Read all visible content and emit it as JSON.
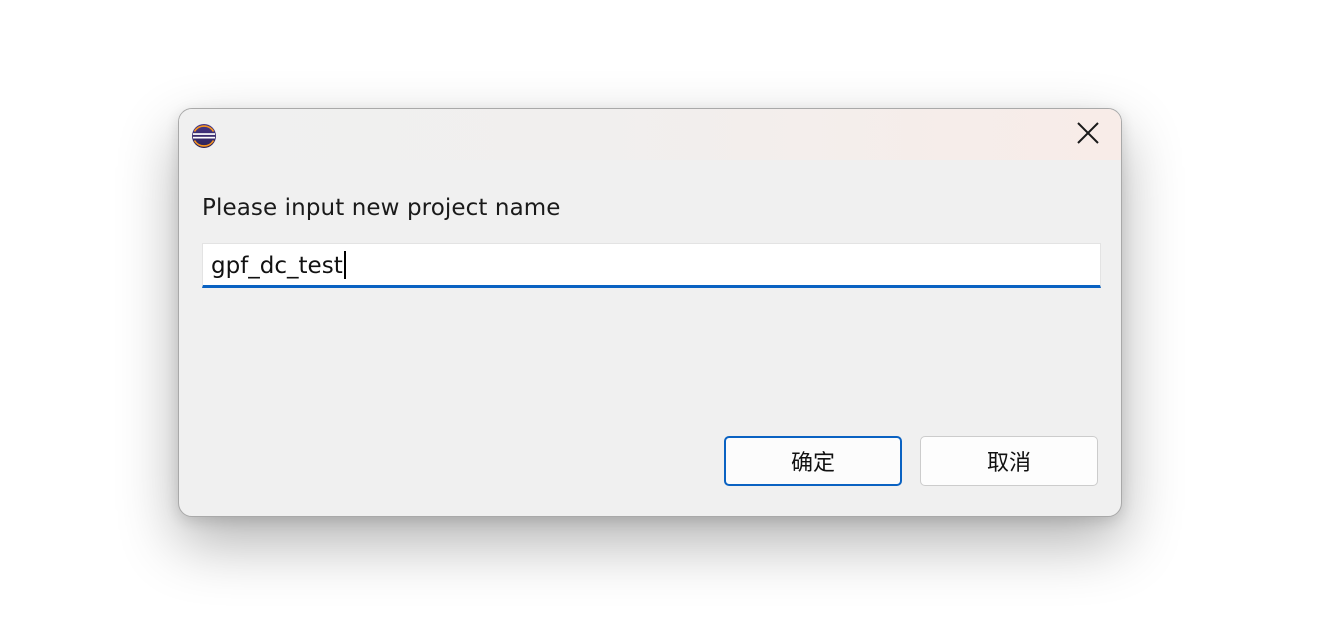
{
  "dialog": {
    "app_icon": "eclipse-icon",
    "close_icon": "close-icon",
    "prompt": "Please input new project name",
    "input_value": "gpf_dc_test",
    "ok_label": "确定",
    "cancel_label": "取消",
    "accent_color": "#0a62c2"
  }
}
